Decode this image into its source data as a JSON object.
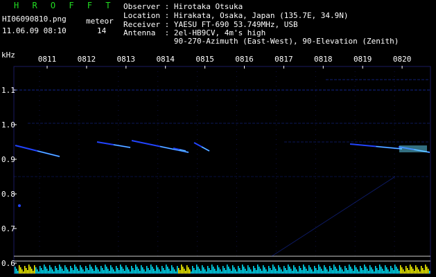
{
  "header": {
    "app_title": "H R O F F T",
    "filename": "HI06090810.png",
    "meteor_label": "meteor",
    "datetime": "11.06.09 08:10",
    "meteor_count": "14",
    "observer": "Observer : Hirotaka Otsuka",
    "location": "Location : Hirakata, Osaka, Japan (135.7E, 34.9N)",
    "receiver": "Receiver : YAESU FT-690 53.749MHz, USB",
    "antenna": "Antenna  : 2el-HB9CV, 4m's high",
    "antenna2": "           90-270-Azimuth (East-West), 90-Elevation (Zenith)"
  },
  "plot": {
    "y_unit": "kHz",
    "time_labels": [
      "0811",
      "0812",
      "0813",
      "0814",
      "0815",
      "0816",
      "0817",
      "0818",
      "0819",
      "0820"
    ],
    "freq_labels": [
      "1.1",
      "1.0",
      "0.9",
      "0.8",
      "0.7",
      "0.6"
    ],
    "colors": {
      "background": "#000000",
      "frame": "#1a1a60",
      "trace": "#2244ff",
      "bright": "#66ddff",
      "cyan": "#00e5ff",
      "yellow": "#ffff00"
    }
  }
}
